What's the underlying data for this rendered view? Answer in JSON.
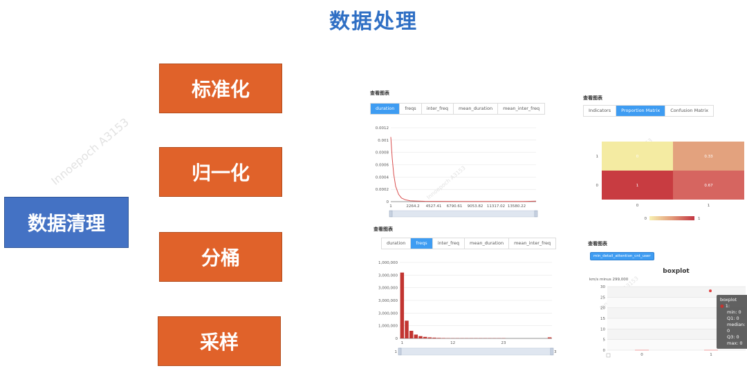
{
  "title": "数据处理",
  "main": "数据清理",
  "steps": [
    "标准化",
    "归一化",
    "分桶",
    "采样"
  ],
  "watermark": "Innoepoch A3153",
  "panel_label": "查看图表",
  "top_left": {
    "tabs": [
      "duration",
      "freqs",
      "inter_freq",
      "mean_duration",
      "mean_inter_freq"
    ],
    "active": 0,
    "chart_data": {
      "type": "line",
      "x_ticks": [
        "1",
        "2264.2",
        "4527.41",
        "6790.61",
        "9053.82",
        "11317.02",
        "13580.22"
      ],
      "y_ticks": [
        "0",
        "0.0002",
        "0.0004",
        "0.0006",
        "0.0008",
        "0.001",
        "0.0012"
      ],
      "ylim": [
        0,
        0.0012
      ],
      "xlim": [
        1,
        15000
      ],
      "x": [
        1,
        150,
        300,
        500,
        800,
        1100,
        1500,
        2000,
        2600,
        3500,
        5000,
        7000,
        10000,
        13580,
        15000
      ],
      "y": [
        0.00105,
        0.0007,
        0.00045,
        0.00025,
        0.00012,
        6e-05,
        3e-05,
        1.5e-05,
        1e-05,
        6e-06,
        4e-06,
        3e-06,
        2e-06,
        2e-06,
        8e-06
      ],
      "color": "#d94e4e"
    }
  },
  "top_right": {
    "tabs": [
      "Indicators",
      "Proportion Matrix",
      "Confusion Matrix"
    ],
    "active": 1,
    "chart_data": {
      "type": "heatmap",
      "x_labels": [
        "0",
        "1"
      ],
      "y_labels": [
        "1",
        "0"
      ],
      "cells": [
        [
          "0",
          "0.33"
        ],
        [
          "1",
          "0.67"
        ]
      ],
      "colors": [
        [
          "#f4eba2",
          "#e3a27e"
        ],
        [
          "#c83c41",
          "#d66560"
        ]
      ],
      "scale_min": "0",
      "scale_max": "1"
    }
  },
  "bottom_left": {
    "tabs": [
      "duration",
      "freqs",
      "inter_freq",
      "mean_duration",
      "mean_inter_freq"
    ],
    "active": 1,
    "chart_data": {
      "type": "bar",
      "y_ticks": [
        "0",
        "1,000,000",
        "2,000,000",
        "3,000,000",
        "4,000,000",
        "5,000,000",
        "6,000,000"
      ],
      "y_tick_labels": [
        "0",
        "1,000,000",
        "3,000,000",
        "3,000,000",
        "3,000,000",
        "3,000,000",
        "1,000,000"
      ],
      "ylim": [
        0,
        6000000
      ],
      "x_ticks": [
        "1",
        "12",
        "23"
      ],
      "values": [
        5200000,
        1400000,
        600000,
        300000,
        180000,
        120000,
        80000,
        60000,
        40000,
        30000,
        20000,
        15000,
        10000,
        8000,
        6000,
        5000,
        4000,
        3000,
        2500,
        2000,
        1500,
        1200,
        1000
      ],
      "last_value": 80000,
      "slider_right": "32.6",
      "slider_left": "1",
      "color": "#c23531"
    }
  },
  "bottom_right": {
    "button": "min_detail_attention_cnt_user",
    "chart_data": {
      "type": "scatter",
      "title": "boxplot",
      "subtitle": "km/s minus 299,000",
      "y_ticks": [
        "0",
        "5",
        "10",
        "15",
        "20",
        "25",
        "30"
      ],
      "ylim": [
        0,
        30
      ],
      "x_ticks": [
        "0",
        "1"
      ],
      "points": [
        {
          "x": "1",
          "y": 28
        }
      ],
      "tooltip": [
        "boxplot",
        "1:",
        "min: 0",
        "Q1: 0",
        "median: 0",
        "Q3: 0",
        "max: 0"
      ]
    }
  }
}
